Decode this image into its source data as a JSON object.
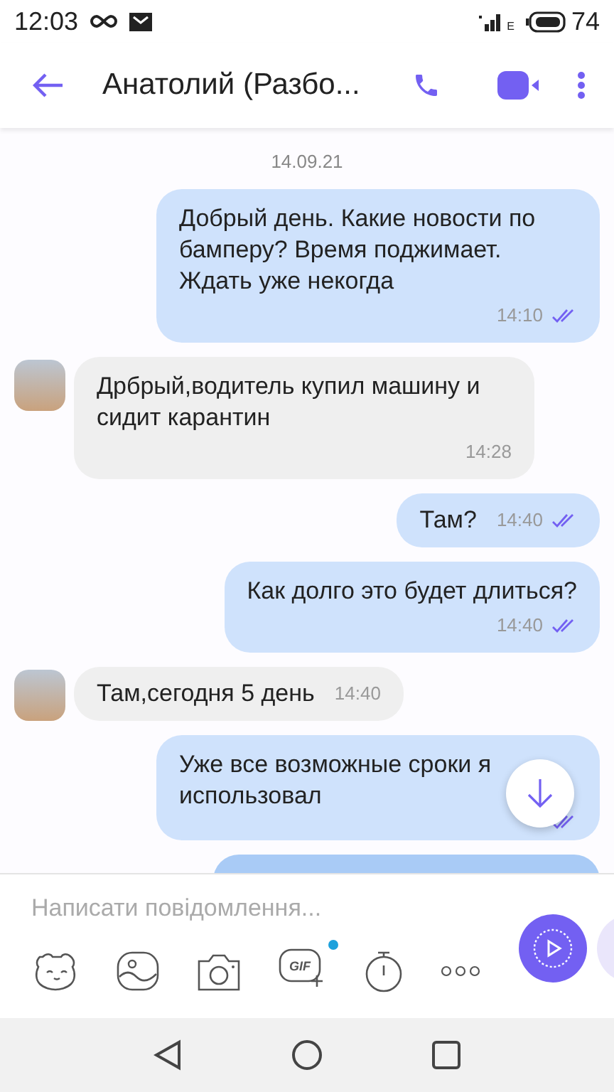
{
  "status_bar": {
    "time": "12:03",
    "network": "E",
    "battery": "74"
  },
  "header": {
    "title": "Анатолий (Разбо..."
  },
  "date_label": "14.09.21",
  "messages": [
    {
      "kind": "outgoing",
      "text": "Добрый день. Какие новости по бамперу? Время поджимает. Ждать уже некогда",
      "time": "14:10",
      "read": true,
      "inline": false
    },
    {
      "kind": "incoming",
      "text": "Дрбрый,водитель купил машину и сидит карантин",
      "time": "14:28",
      "avatar": true,
      "inline": false
    },
    {
      "kind": "outgoing",
      "text": "Там?",
      "time": "14:40",
      "read": true,
      "inline": true
    },
    {
      "kind": "outgoing",
      "text": "Как долго это будет длиться?",
      "time": "14:40",
      "read": true,
      "inline": false
    },
    {
      "kind": "incoming",
      "text": "Там,сегодня 5 день",
      "time": "14:40",
      "avatar": true,
      "inline": true
    },
    {
      "kind": "outgoing",
      "text": "Уже все возможные сроки я использовал",
      "read": true,
      "inline": false
    },
    {
      "kind": "partial"
    }
  ],
  "composer": {
    "placeholder": "Написати повідомлення...",
    "gif_new": true,
    "gif_label": "GIF"
  }
}
